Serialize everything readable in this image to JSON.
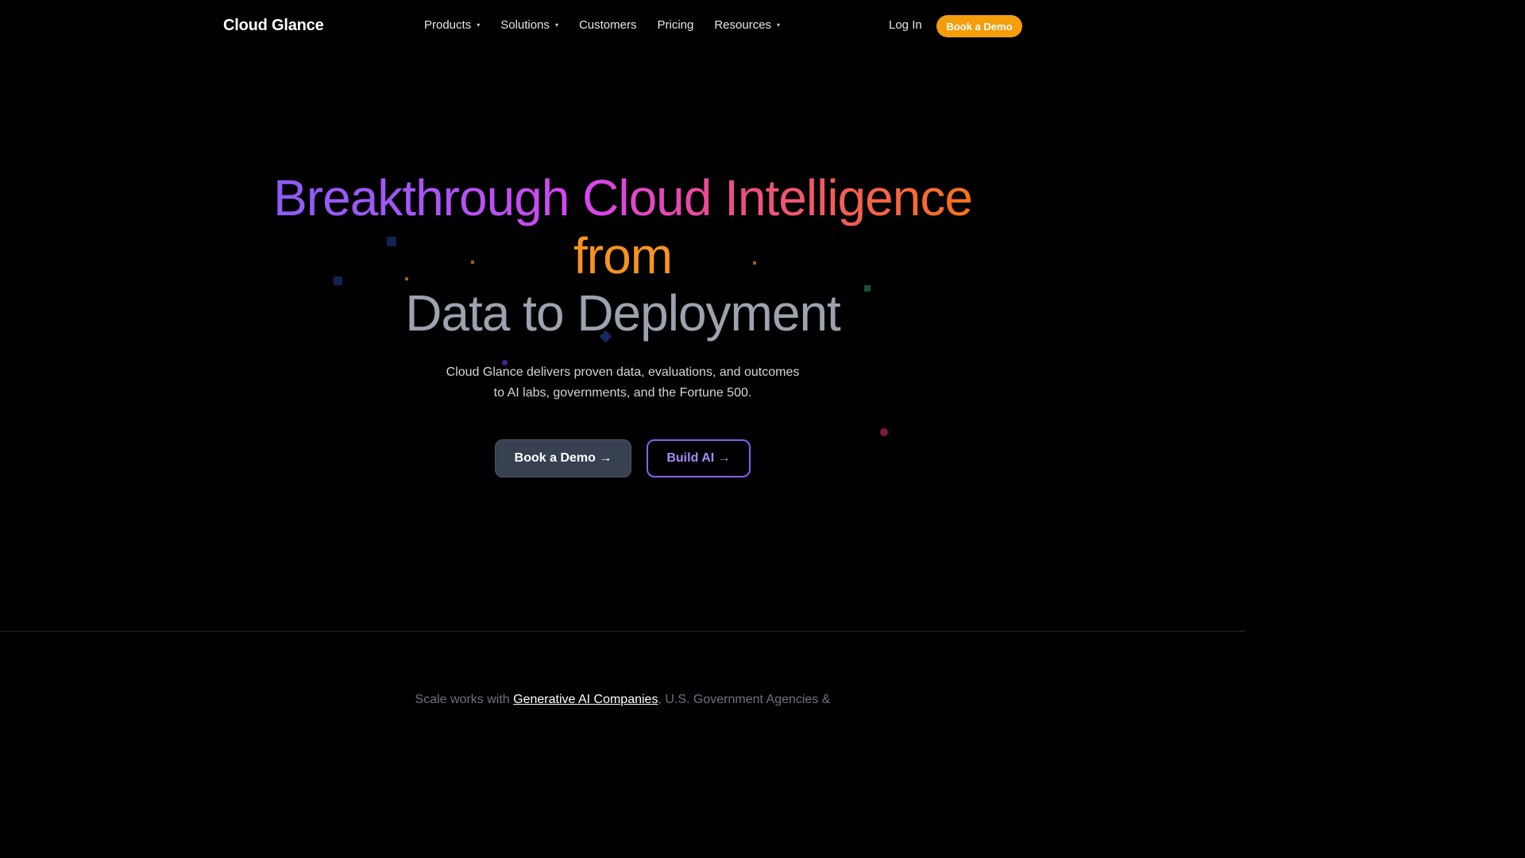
{
  "brand": {
    "name": "Cloud Glance"
  },
  "nav": {
    "items": [
      {
        "label": "Products",
        "has_dropdown": true,
        "caret": "▾"
      },
      {
        "label": "Solutions",
        "has_dropdown": true,
        "caret": "▾"
      },
      {
        "label": "Customers",
        "has_dropdown": false
      },
      {
        "label": "Pricing",
        "has_dropdown": false
      },
      {
        "label": "Resources",
        "has_dropdown": true,
        "caret": "▾"
      }
    ],
    "login_label": "Log In",
    "demo_label": "Book a Demo"
  },
  "hero": {
    "title_line1": "Breakthrough Cloud Intelligence",
    "title_line2": "from",
    "title_line3": "Data to Deployment",
    "subtitle_line1": "Cloud Glance delivers proven data, evaluations, and outcomes",
    "subtitle_line2": "to AI labs, governments, and the Fortune 500.",
    "primary_cta": "Book a Demo →",
    "secondary_cta": "Build AI →"
  },
  "trust": {
    "prefix": "Scale works with ",
    "highlight": "Generative AI Companies",
    "suffix": ", U.S. Government Agencies &"
  },
  "colors": {
    "accent_orange": "#f59e0b",
    "accent_purple": "#8b5cf6",
    "gradient_start": "#8b5cf6",
    "gradient_mid": "#ec4899",
    "gradient_end": "#f97316",
    "background": "#000000"
  }
}
